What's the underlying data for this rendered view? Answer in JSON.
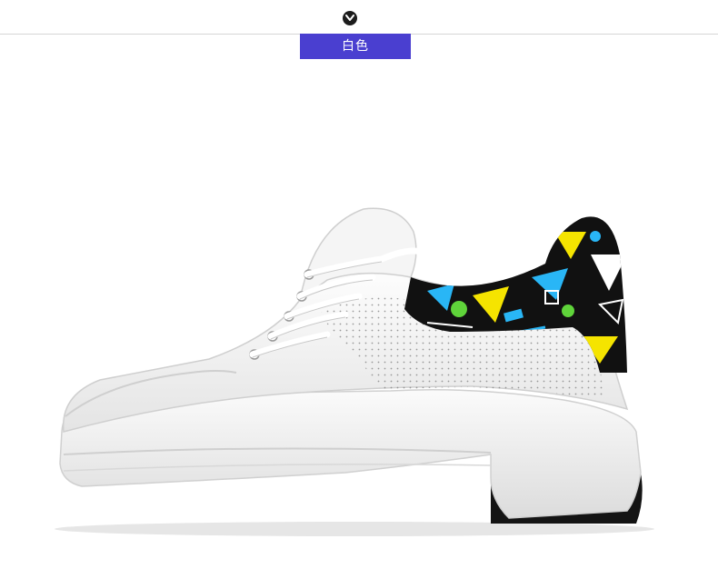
{
  "header": {
    "color_tag_label": "白色",
    "tag_color": "#4a3fd0",
    "chevron_icon": "chevron-down-icon"
  },
  "product": {
    "image_subject": "white-sneaker-with-geometric-pattern-heel",
    "colors": {
      "upper": "#f2f2f2",
      "sole": "#ededed",
      "heel_pattern_base": "#111111",
      "accent_blue": "#29b6f6",
      "accent_yellow": "#f5e400",
      "accent_green": "#5fd43a",
      "outsole_black": "#141414"
    }
  }
}
